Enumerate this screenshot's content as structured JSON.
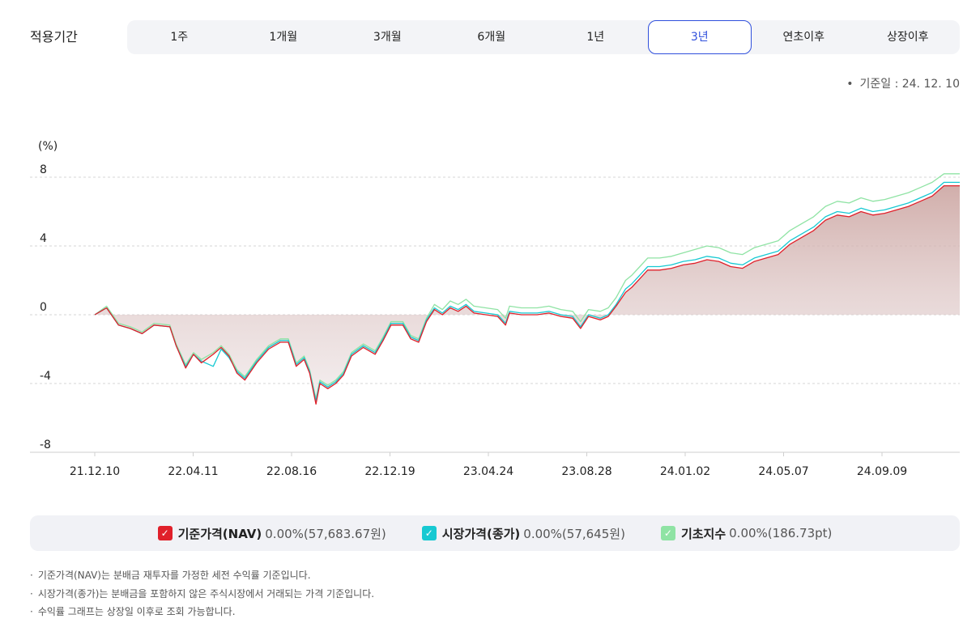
{
  "period": {
    "label": "적용기간",
    "tabs": [
      "1주",
      "1개월",
      "3개월",
      "6개월",
      "1년",
      "3년",
      "연초이후",
      "상장이후"
    ],
    "active_index": 5
  },
  "reference_date": "기준일 : 24. 12. 10",
  "chart_data": {
    "type": "area",
    "ylabel": "(%)",
    "ylim": [
      -8,
      8
    ],
    "yticks": [
      "8",
      "4",
      "0",
      "-4",
      "-8"
    ],
    "x_tick_labels": [
      "21.12.10",
      "22.04.11",
      "22.08.16",
      "22.12.19",
      "23.04.24",
      "23.08.28",
      "24.01.02",
      "24.05.07",
      "24.09.09"
    ],
    "x_range_days": [
      0,
      1095
    ],
    "grid": "horizontal dashed",
    "legend": "bottom",
    "series": [
      {
        "name": "기준가격(NAV)",
        "color": "#e0202a",
        "points": [
          [
            0,
            0.0
          ],
          [
            15,
            0.4
          ],
          [
            30,
            -0.6
          ],
          [
            45,
            -0.8
          ],
          [
            60,
            -1.1
          ],
          [
            75,
            -0.6
          ],
          [
            95,
            -0.7
          ],
          [
            103,
            -1.8
          ],
          [
            115,
            -3.1
          ],
          [
            125,
            -2.3
          ],
          [
            135,
            -2.8
          ],
          [
            150,
            -2.3
          ],
          [
            160,
            -1.9
          ],
          [
            170,
            -2.4
          ],
          [
            180,
            -3.4
          ],
          [
            190,
            -3.8
          ],
          [
            205,
            -2.8
          ],
          [
            220,
            -2.0
          ],
          [
            235,
            -1.6
          ],
          [
            245,
            -1.6
          ],
          [
            255,
            -3.0
          ],
          [
            265,
            -2.6
          ],
          [
            272,
            -3.4
          ],
          [
            280,
            -5.2
          ],
          [
            285,
            -4.0
          ],
          [
            295,
            -4.3
          ],
          [
            305,
            -4.0
          ],
          [
            315,
            -3.5
          ],
          [
            325,
            -2.4
          ],
          [
            340,
            -1.9
          ],
          [
            355,
            -2.3
          ],
          [
            365,
            -1.5
          ],
          [
            375,
            -0.6
          ],
          [
            390,
            -0.6
          ],
          [
            400,
            -1.4
          ],
          [
            410,
            -1.6
          ],
          [
            420,
            -0.4
          ],
          [
            430,
            0.3
          ],
          [
            440,
            0.0
          ],
          [
            450,
            0.4
          ],
          [
            460,
            0.2
          ],
          [
            470,
            0.5
          ],
          [
            480,
            0.1
          ],
          [
            495,
            0.0
          ],
          [
            510,
            -0.1
          ],
          [
            520,
            -0.6
          ],
          [
            525,
            0.1
          ],
          [
            540,
            0.0
          ],
          [
            560,
            0.0
          ],
          [
            575,
            0.1
          ],
          [
            590,
            -0.1
          ],
          [
            605,
            -0.2
          ],
          [
            615,
            -0.8
          ],
          [
            625,
            -0.1
          ],
          [
            640,
            -0.3
          ],
          [
            650,
            -0.1
          ],
          [
            660,
            0.5
          ],
          [
            672,
            1.3
          ],
          [
            680,
            1.6
          ],
          [
            690,
            2.1
          ],
          [
            700,
            2.6
          ],
          [
            715,
            2.6
          ],
          [
            730,
            2.7
          ],
          [
            745,
            2.9
          ],
          [
            760,
            3.0
          ],
          [
            775,
            3.2
          ],
          [
            790,
            3.1
          ],
          [
            805,
            2.8
          ],
          [
            820,
            2.7
          ],
          [
            835,
            3.1
          ],
          [
            850,
            3.3
          ],
          [
            865,
            3.5
          ],
          [
            880,
            4.1
          ],
          [
            895,
            4.5
          ],
          [
            910,
            4.9
          ],
          [
            925,
            5.5
          ],
          [
            940,
            5.8
          ],
          [
            955,
            5.7
          ],
          [
            970,
            6.0
          ],
          [
            985,
            5.8
          ],
          [
            1000,
            5.9
          ],
          [
            1015,
            6.1
          ],
          [
            1030,
            6.3
          ],
          [
            1045,
            6.6
          ],
          [
            1060,
            6.9
          ],
          [
            1075,
            7.5
          ],
          [
            1095,
            7.5
          ]
        ]
      },
      {
        "name": "시장가격(종가)",
        "color": "#17c9d2",
        "points": [
          [
            0,
            0.0
          ],
          [
            15,
            0.4
          ],
          [
            30,
            -0.6
          ],
          [
            45,
            -0.8
          ],
          [
            60,
            -1.1
          ],
          [
            75,
            -0.6
          ],
          [
            95,
            -0.7
          ],
          [
            103,
            -1.8
          ],
          [
            115,
            -3.0
          ],
          [
            125,
            -2.3
          ],
          [
            135,
            -2.7
          ],
          [
            150,
            -3.0
          ],
          [
            160,
            -2.0
          ],
          [
            170,
            -2.5
          ],
          [
            180,
            -3.3
          ],
          [
            190,
            -3.7
          ],
          [
            205,
            -2.7
          ],
          [
            220,
            -1.9
          ],
          [
            235,
            -1.5
          ],
          [
            245,
            -1.5
          ],
          [
            255,
            -2.9
          ],
          [
            265,
            -2.5
          ],
          [
            272,
            -3.3
          ],
          [
            280,
            -5.0
          ],
          [
            285,
            -3.9
          ],
          [
            295,
            -4.2
          ],
          [
            305,
            -3.9
          ],
          [
            315,
            -3.4
          ],
          [
            325,
            -2.3
          ],
          [
            340,
            -1.8
          ],
          [
            355,
            -2.2
          ],
          [
            365,
            -1.4
          ],
          [
            375,
            -0.5
          ],
          [
            390,
            -0.5
          ],
          [
            400,
            -1.3
          ],
          [
            410,
            -1.5
          ],
          [
            420,
            -0.3
          ],
          [
            430,
            0.4
          ],
          [
            440,
            0.1
          ],
          [
            450,
            0.5
          ],
          [
            460,
            0.3
          ],
          [
            470,
            0.6
          ],
          [
            480,
            0.2
          ],
          [
            495,
            0.1
          ],
          [
            510,
            0.0
          ],
          [
            520,
            -0.5
          ],
          [
            525,
            0.2
          ],
          [
            540,
            0.1
          ],
          [
            560,
            0.1
          ],
          [
            575,
            0.2
          ],
          [
            590,
            0.0
          ],
          [
            605,
            -0.1
          ],
          [
            615,
            -0.7
          ],
          [
            625,
            0.0
          ],
          [
            640,
            -0.2
          ],
          [
            650,
            0.0
          ],
          [
            660,
            0.6
          ],
          [
            672,
            1.5
          ],
          [
            680,
            1.8
          ],
          [
            690,
            2.3
          ],
          [
            700,
            2.8
          ],
          [
            715,
            2.8
          ],
          [
            730,
            2.9
          ],
          [
            745,
            3.1
          ],
          [
            760,
            3.2
          ],
          [
            775,
            3.4
          ],
          [
            790,
            3.3
          ],
          [
            805,
            3.0
          ],
          [
            820,
            2.9
          ],
          [
            835,
            3.3
          ],
          [
            850,
            3.5
          ],
          [
            865,
            3.7
          ],
          [
            880,
            4.3
          ],
          [
            895,
            4.7
          ],
          [
            910,
            5.1
          ],
          [
            925,
            5.7
          ],
          [
            940,
            6.0
          ],
          [
            955,
            5.9
          ],
          [
            970,
            6.2
          ],
          [
            985,
            6.0
          ],
          [
            1000,
            6.1
          ],
          [
            1015,
            6.3
          ],
          [
            1030,
            6.5
          ],
          [
            1045,
            6.8
          ],
          [
            1060,
            7.1
          ],
          [
            1075,
            7.7
          ],
          [
            1095,
            7.7
          ]
        ]
      },
      {
        "name": "기초지수",
        "color": "#8fe3a4",
        "points": [
          [
            0,
            0.0
          ],
          [
            15,
            0.5
          ],
          [
            30,
            -0.5
          ],
          [
            45,
            -0.7
          ],
          [
            60,
            -1.0
          ],
          [
            75,
            -0.5
          ],
          [
            95,
            -0.6
          ],
          [
            103,
            -1.7
          ],
          [
            115,
            -2.9
          ],
          [
            125,
            -2.2
          ],
          [
            135,
            -2.6
          ],
          [
            150,
            -2.2
          ],
          [
            160,
            -1.8
          ],
          [
            170,
            -2.3
          ],
          [
            180,
            -3.2
          ],
          [
            190,
            -3.6
          ],
          [
            205,
            -2.6
          ],
          [
            220,
            -1.8
          ],
          [
            235,
            -1.4
          ],
          [
            245,
            -1.4
          ],
          [
            255,
            -2.8
          ],
          [
            265,
            -2.4
          ],
          [
            272,
            -3.2
          ],
          [
            280,
            -4.9
          ],
          [
            285,
            -3.8
          ],
          [
            295,
            -4.1
          ],
          [
            305,
            -3.8
          ],
          [
            315,
            -3.3
          ],
          [
            325,
            -2.2
          ],
          [
            340,
            -1.7
          ],
          [
            355,
            -2.1
          ],
          [
            365,
            -1.3
          ],
          [
            375,
            -0.4
          ],
          [
            390,
            -0.4
          ],
          [
            400,
            -1.2
          ],
          [
            410,
            -1.4
          ],
          [
            420,
            -0.2
          ],
          [
            430,
            0.6
          ],
          [
            440,
            0.3
          ],
          [
            450,
            0.8
          ],
          [
            460,
            0.6
          ],
          [
            470,
            0.9
          ],
          [
            480,
            0.5
          ],
          [
            495,
            0.4
          ],
          [
            510,
            0.3
          ],
          [
            520,
            -0.2
          ],
          [
            525,
            0.5
          ],
          [
            540,
            0.4
          ],
          [
            560,
            0.4
          ],
          [
            575,
            0.5
          ],
          [
            590,
            0.3
          ],
          [
            605,
            0.2
          ],
          [
            615,
            -0.4
          ],
          [
            625,
            0.3
          ],
          [
            640,
            0.2
          ],
          [
            650,
            0.4
          ],
          [
            660,
            1.0
          ],
          [
            672,
            2.0
          ],
          [
            680,
            2.3
          ],
          [
            690,
            2.8
          ],
          [
            700,
            3.3
          ],
          [
            715,
            3.3
          ],
          [
            730,
            3.4
          ],
          [
            745,
            3.6
          ],
          [
            760,
            3.8
          ],
          [
            775,
            4.0
          ],
          [
            790,
            3.9
          ],
          [
            805,
            3.6
          ],
          [
            820,
            3.5
          ],
          [
            835,
            3.9
          ],
          [
            850,
            4.1
          ],
          [
            865,
            4.3
          ],
          [
            880,
            4.9
          ],
          [
            895,
            5.3
          ],
          [
            910,
            5.7
          ],
          [
            925,
            6.3
          ],
          [
            940,
            6.6
          ],
          [
            955,
            6.5
          ],
          [
            970,
            6.8
          ],
          [
            985,
            6.6
          ],
          [
            1000,
            6.7
          ],
          [
            1015,
            6.9
          ],
          [
            1030,
            7.1
          ],
          [
            1045,
            7.4
          ],
          [
            1060,
            7.7
          ],
          [
            1075,
            8.2
          ],
          [
            1095,
            8.2
          ]
        ]
      }
    ]
  },
  "legend": [
    {
      "name": "기준가격(NAV)",
      "value": "0.00%(57,683.67원)",
      "color": "#e0202a"
    },
    {
      "name": "시장가격(종가)",
      "value": "0.00%(57,645원)",
      "color": "#17c9d2"
    },
    {
      "name": "기초지수",
      "value": "0.00%(186.73pt)",
      "color": "#8fe3a4"
    }
  ],
  "notes": [
    "기준가격(NAV)는 분배금 재투자를 가정한 세전 수익률 기준입니다.",
    "시장가격(종가)는 분배금을 포함하지 않은 주식시장에서 거래되는 가격 기준입니다.",
    "수익률 그래프는 상장일 이후로 조회 가능합니다."
  ],
  "icons": {
    "check": "check-icon"
  }
}
